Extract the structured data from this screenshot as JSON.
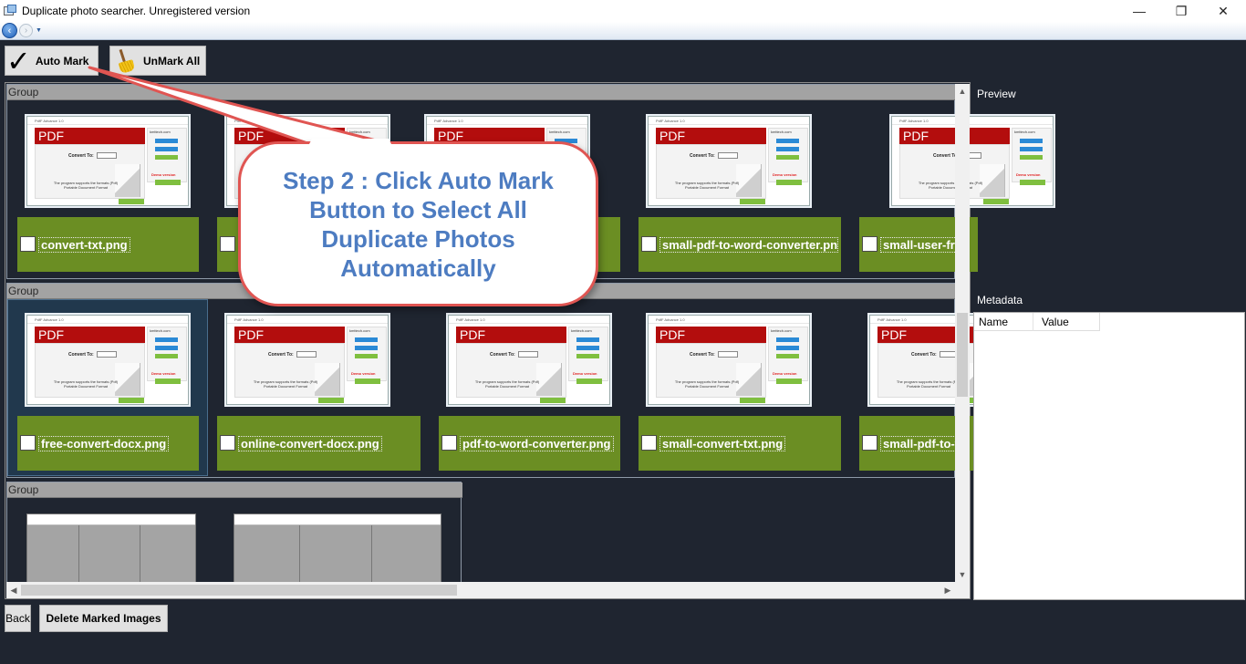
{
  "window": {
    "title": "Duplicate photo searcher. Unregistered version",
    "controls": {
      "minimize": "—",
      "maximize": "❐",
      "close": "✕"
    }
  },
  "nav": {
    "back": "‹",
    "forward": "›"
  },
  "toolbar": {
    "auto_mark_label": "Auto Mark",
    "unmark_all_label": "UnMark All"
  },
  "groups": [
    {
      "header": "Group",
      "items": [
        {
          "filename": "convert-txt.png",
          "selected": false
        },
        {
          "filename": "",
          "selected": false
        },
        {
          "filename": "",
          "selected": false
        },
        {
          "filename": "small-pdf-to-word-converter.png",
          "selected": false
        },
        {
          "filename": "small-user-fri",
          "selected": false
        }
      ]
    },
    {
      "header": "Group",
      "items": [
        {
          "filename": "free-convert-docx.png",
          "selected": true
        },
        {
          "filename": "online-convert-docx.png",
          "selected": false
        },
        {
          "filename": "pdf-to-word-converter.png",
          "selected": false
        },
        {
          "filename": "small-convert-txt.png",
          "selected": false
        },
        {
          "filename": "small-pdf-to-w",
          "selected": false
        }
      ]
    },
    {
      "header": "Group",
      "items": []
    }
  ],
  "thumbnail_content": {
    "app_title": "PdfF Advance 1.0",
    "pdf_label": "PDF",
    "convert_label": "Convert To:",
    "support_text": "The program supports the formats (Pdf) Portable Document Format",
    "site": "kmttech.com",
    "demo": "Demo version"
  },
  "callout": {
    "text": "Step 2 : Click Auto Mark Button to Select All Duplicate Photos Automatically",
    "border_color": "#e05552",
    "text_color": "#4d7cc1"
  },
  "right_panel": {
    "preview_label": "Preview",
    "metadata_label": "Metadata",
    "columns": [
      "Name",
      "Value"
    ]
  },
  "bottom": {
    "back_label": "Back",
    "delete_label": "Delete Marked Images"
  },
  "colors": {
    "background": "#1f2530",
    "label_band": "#6b8e23",
    "group_header": "#a3a3a3",
    "selected_card": "#21384d"
  }
}
